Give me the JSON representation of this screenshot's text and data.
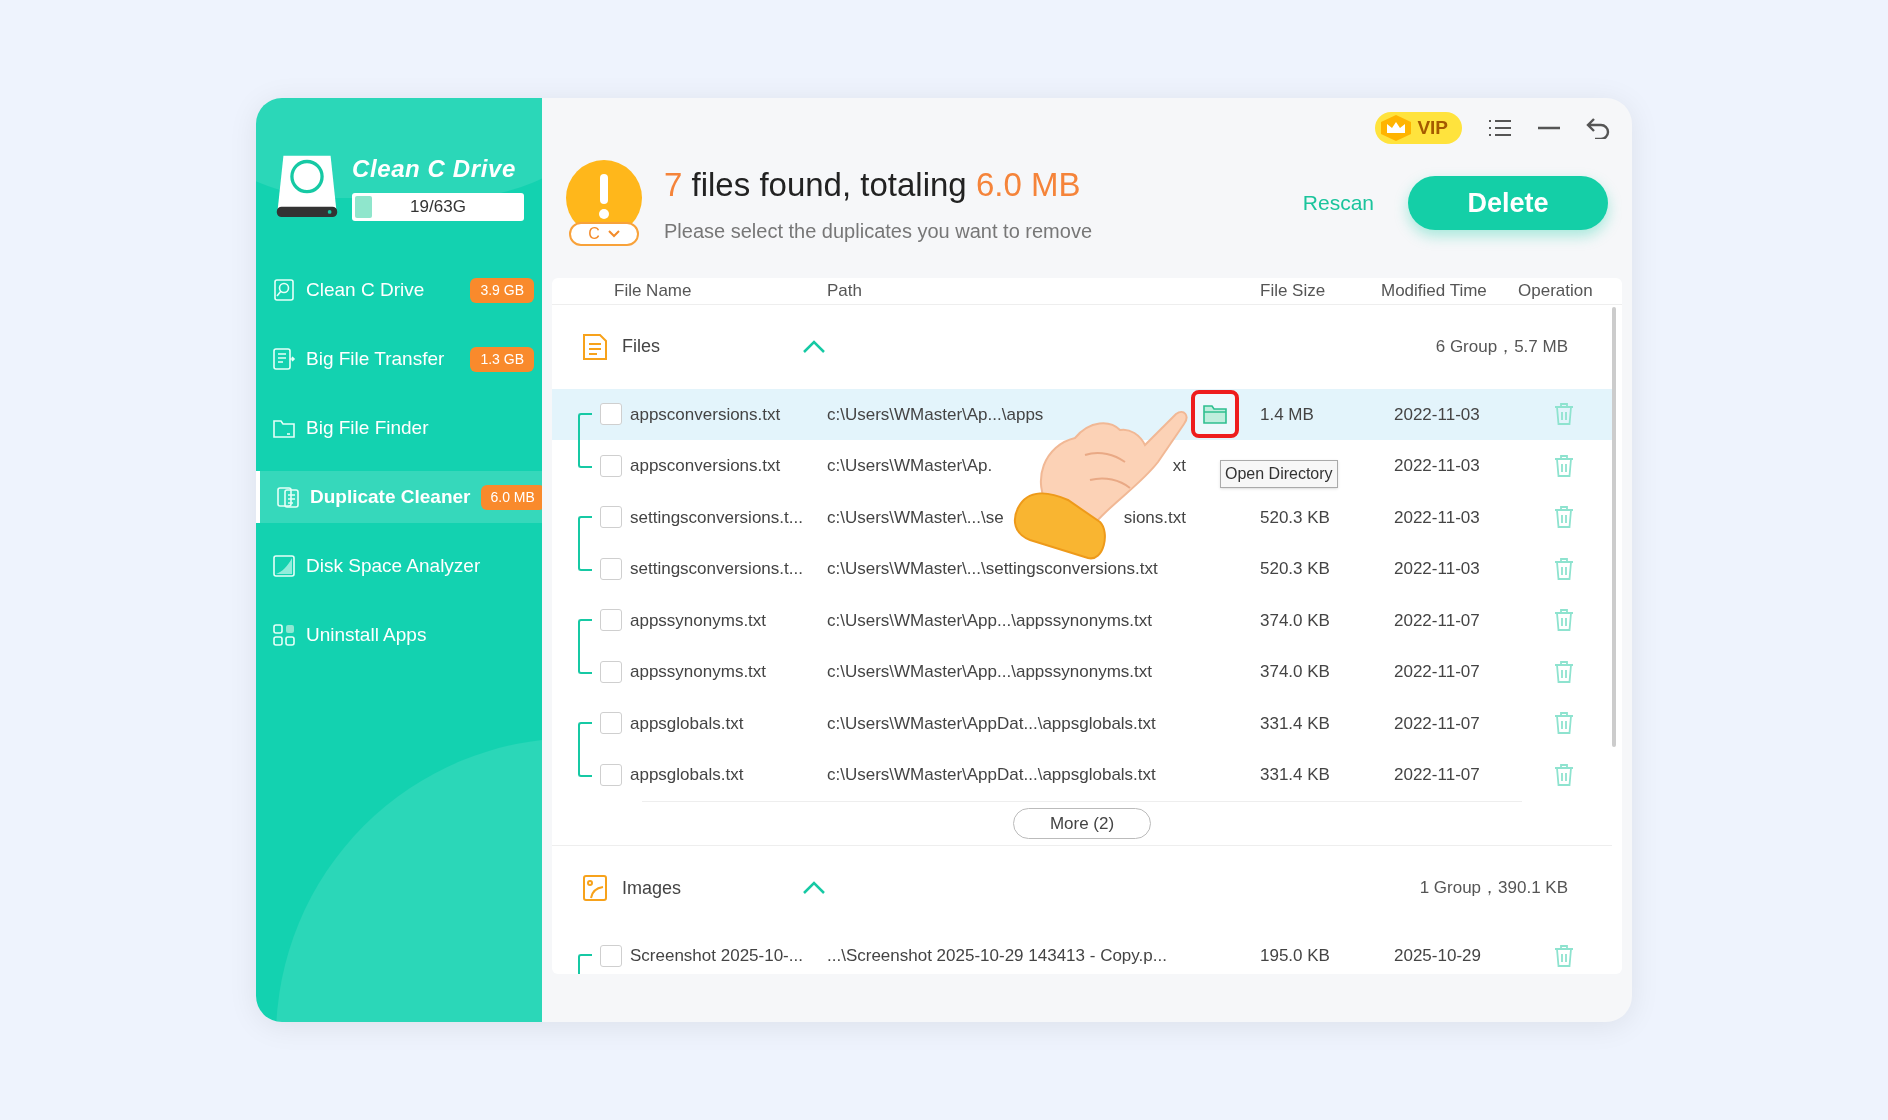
{
  "sidebar": {
    "logo_title": "Clean C Drive",
    "disk_usage": {
      "text": "19/63G",
      "level": 0.1
    },
    "items": [
      {
        "label": "Clean C Drive",
        "badge": "3.9 GB",
        "selected": false
      },
      {
        "label": "Big File Transfer",
        "badge": "1.3 GB",
        "selected": false
      },
      {
        "label": "Big File Finder",
        "selected": false
      },
      {
        "label": "Duplicate Cleaner",
        "badge": "6.0 MB",
        "selected": true
      },
      {
        "label": "Disk Space Analyzer",
        "selected": false
      },
      {
        "label": "Uninstall Apps",
        "selected": false
      }
    ]
  },
  "topbar": {
    "vip": "VIP"
  },
  "summary": {
    "count": "7",
    "text": "files found, totaling",
    "total": "6.0 MB",
    "subtitle": "Please select the duplicates you want to remove",
    "drive": "C"
  },
  "actions": {
    "rescan": "Rescan",
    "delete": "Delete"
  },
  "columns": [
    "File Name",
    "Path",
    "File Size",
    "Modified Time",
    "Operation"
  ],
  "sections": [
    {
      "kind": "files",
      "title": "Files",
      "expanded": true,
      "summary": "6 Group，5.7 MB",
      "more": "More (2)",
      "groups": [
        {
          "files": [
            {
              "name": "appsconversions.txt",
              "path": "c:\\Users\\WMaster\\Ap...\\apps",
              "size": "1.4 MB",
              "modified": "2022-11-03",
              "checked": false,
              "highlighted": true,
              "open_directory": true
            },
            {
              "name": "appsconversions.txt",
              "path": "c:\\Users\\WMaster\\Ap.",
              "path_tail": "xt",
              "modified": "2022-11-03",
              "checked": false,
              "highlighted": false,
              "open_directory": false
            }
          ]
        },
        {
          "files": [
            {
              "name": "settingsconversions.t...",
              "path": "c:\\Users\\WMaster\\...\\se",
              "path_tail": "sions.txt",
              "size": "520.3 KB",
              "modified": "2022-11-03",
              "checked": false,
              "highlighted": false,
              "open_directory": false
            },
            {
              "name": "settingsconversions.t...",
              "path": "c:\\Users\\WMaster\\...\\settingsconversions.txt",
              "size": "520.3 KB",
              "modified": "2022-11-03",
              "checked": false,
              "highlighted": false,
              "open_directory": false
            }
          ]
        },
        {
          "files": [
            {
              "name": "appssynonyms.txt",
              "path": "c:\\Users\\WMaster\\App...\\appssynonyms.txt",
              "size": "374.0 KB",
              "modified": "2022-11-07",
              "checked": false,
              "highlighted": false,
              "open_directory": false
            },
            {
              "name": "appssynonyms.txt",
              "path": "c:\\Users\\WMaster\\App...\\appssynonyms.txt",
              "size": "374.0 KB",
              "modified": "2022-11-07",
              "checked": false,
              "highlighted": false,
              "open_directory": false
            }
          ]
        },
        {
          "files": [
            {
              "name": "appsglobals.txt",
              "path": "c:\\Users\\WMaster\\AppDat...\\appsglobals.txt",
              "size": "331.4 KB",
              "modified": "2022-11-07",
              "checked": false,
              "highlighted": false,
              "open_directory": false
            },
            {
              "name": "appsglobals.txt",
              "path": "c:\\Users\\WMaster\\AppDat...\\appsglobals.txt",
              "size": "331.4 KB",
              "modified": "2022-11-07",
              "checked": false,
              "highlighted": false,
              "open_directory": false
            }
          ]
        }
      ]
    },
    {
      "kind": "images",
      "title": "Images",
      "expanded": true,
      "summary": "1 Group，390.1 KB",
      "groups": [
        {
          "files": [
            {
              "name": "Screenshot 2025-10-...",
              "path": "...\\Screenshot 2025-10-29 143413 - Copy.p...",
              "size": "195.0 KB",
              "modified": "2025-10-29",
              "checked": false,
              "highlighted": false,
              "open_directory": false
            }
          ]
        }
      ]
    }
  ],
  "tooltip": "Open Directory"
}
